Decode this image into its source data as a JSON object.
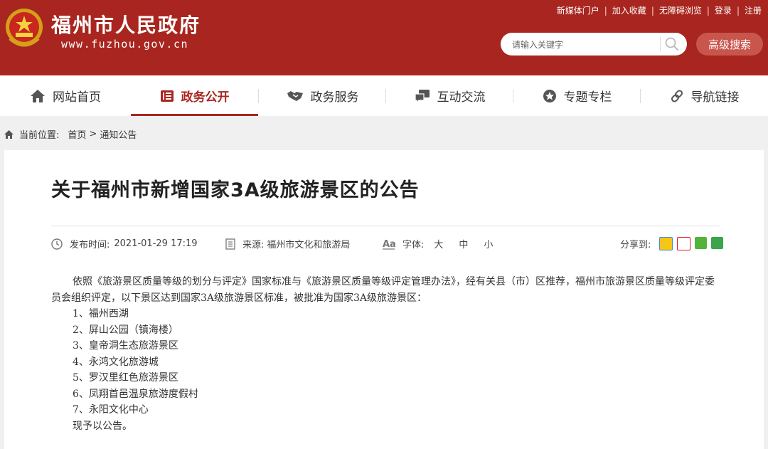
{
  "header": {
    "site_name": "福州市人民政府",
    "site_url": "www.fuzhou.gov.cn",
    "top_links": [
      "新媒体门户",
      "加入收藏",
      "无障碍浏览",
      "登录",
      "注册"
    ],
    "search_placeholder": "请输入关键字",
    "advanced_search": "高级搜索",
    "brand_color": "#a8261f"
  },
  "nav": {
    "items": [
      {
        "label": "网站首页",
        "icon": "home-icon"
      },
      {
        "label": "政务公开",
        "icon": "document-list-icon",
        "active": true
      },
      {
        "label": "政务服务",
        "icon": "handshake-icon"
      },
      {
        "label": "互动交流",
        "icon": "chat-icon"
      },
      {
        "label": "专题专栏",
        "icon": "star-icon"
      },
      {
        "label": "导航链接",
        "icon": "link-icon"
      }
    ]
  },
  "breadcrumb": {
    "prefix": "当前位置:",
    "home": "首页",
    "separator": ">",
    "current": "通知公告"
  },
  "article": {
    "title": "关于福州市新增国家3A级旅游景区的公告",
    "publish_label": "发布时间:",
    "publish_time": "2021-01-29 17:19",
    "source_label": "来源:",
    "source": "福州市文化和旅游局",
    "font_label": "字体:",
    "font_sizes": [
      "大",
      "中",
      "小"
    ],
    "share_label": "分享到:",
    "intro": "依照《旅游景区质量等级的划分与评定》国家标准与《旅游景区质量等级评定管理办法》，经有关县（市）区推荐，福州市旅游景区质量等级评定委员会组织评定，以下景区达到国家3A级旅游景区标准，被批准为国家3A级旅游景区：",
    "items": [
      "1、福州西湖",
      "2、屏山公园（镇海楼）",
      "3、皇帝洞生态旅游景区",
      "4、永鸿文化旅游城",
      "5、罗汉里红色旅游景区",
      "6、凤翔首邑温泉旅游度假村",
      "7、永阳文化中心"
    ],
    "closing": "现予以公告。"
  }
}
